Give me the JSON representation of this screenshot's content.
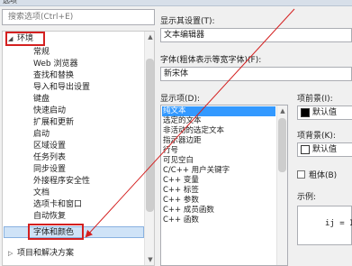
{
  "window": {
    "title": "选项"
  },
  "search": {
    "placeholder": "搜索选项(Ctrl+E)"
  },
  "tree": {
    "parent": "环境",
    "items": [
      "常规",
      "Web 浏览器",
      "查找和替换",
      "导入和导出设置",
      "键盘",
      "快速启动",
      "扩展和更新",
      "启动",
      "区域设置",
      "任务列表",
      "同步设置",
      "外接程序安全性",
      "文档",
      "选项卡和窗口",
      "自动恢复",
      "字体和颜色"
    ],
    "selected": "字体和颜色",
    "next_parent": "项目和解决方案"
  },
  "settings": {
    "show_settings_label": "显示其设置(T):",
    "show_settings_value": "文本编辑器",
    "font_label": "字体(粗体表示等宽字体)(F):",
    "font_value": "新宋体",
    "display_items_label": "显示项(D):",
    "display_items": [
      "纯文本",
      "选定的文本",
      "非活动的选定文本",
      "指示器边距",
      "行号",
      "可见空白",
      "C/C++ 用户关键字",
      "C++ 变量",
      "C++ 标签",
      "C++ 参数",
      "C++ 成员函数",
      "C++ 函数"
    ],
    "foreground_label": "项前景(I):",
    "foreground_value": "默认值",
    "background_label": "项背景(K):",
    "background_value": "默认值",
    "bold_label": "粗体(B)",
    "sample_label": "示例:",
    "sample_text": "ij = I:"
  },
  "colors": {
    "highlight": "#d42020",
    "selection": "#3399ff",
    "arrow": "#d42020"
  }
}
